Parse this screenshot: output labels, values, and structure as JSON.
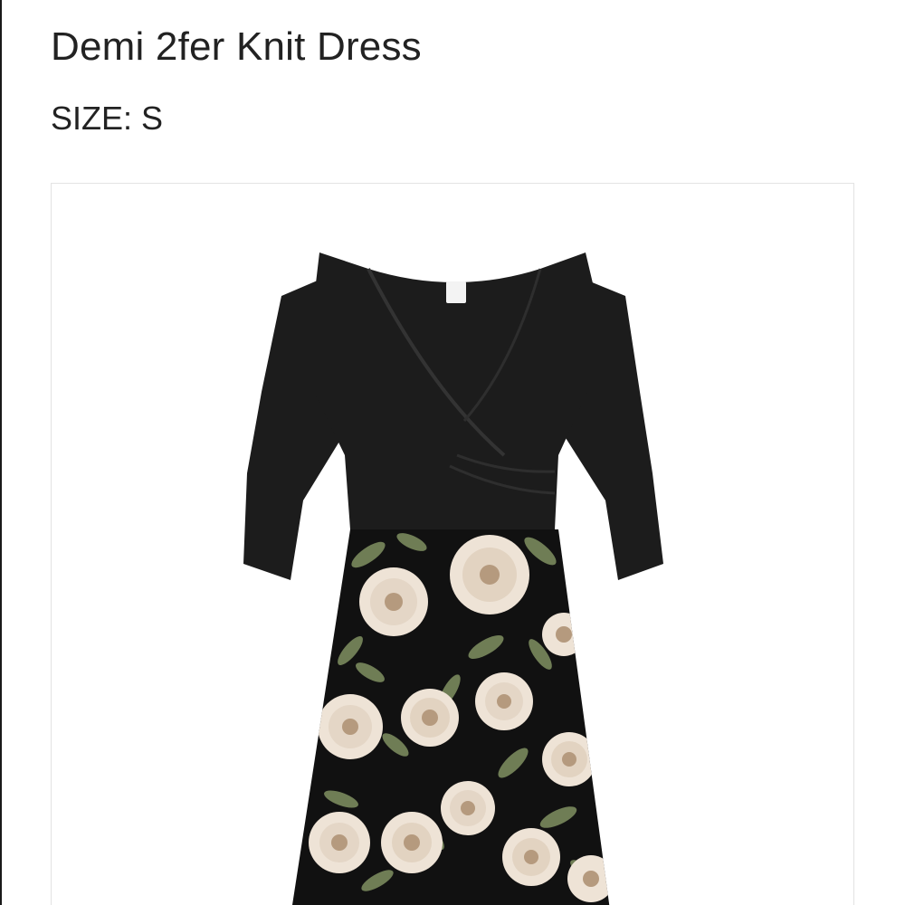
{
  "product": {
    "title": "Demi 2fer Knit Dress",
    "size_text": "SIZE: S"
  },
  "image": {
    "subject": "dress-photo",
    "colors": {
      "bodice": "#1c1c1c",
      "skirt_base": "#111111",
      "flower": "#eee3d6",
      "flower_center": "#b59a7e",
      "leaf": "#6f7d55",
      "frame_border": "#e3e3e3"
    }
  }
}
